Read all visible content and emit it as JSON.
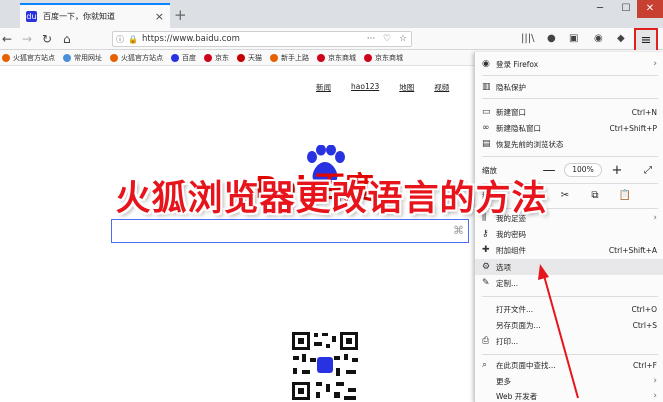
{
  "tab": {
    "title": "百度一下，你就知道",
    "close": "×",
    "favicon": "du"
  },
  "new_tab": "+",
  "window": {
    "minimize": "─",
    "maximize": "☐",
    "close": "✕"
  },
  "nav": {
    "back": "←",
    "forward": "→",
    "reload": "↻",
    "home": "⌂"
  },
  "urlbar": {
    "url": "https://www.baidu.com",
    "info": "ⓘ",
    "lock": "🔒",
    "more": "···",
    "pocket": "♡",
    "star": "☆"
  },
  "toolbar": {
    "library": "|||\\",
    "chat": "●",
    "sidebar": "▣",
    "sync": "◉",
    "extension": "◆",
    "menu": "≡"
  },
  "bookmarks": [
    {
      "label": "火狐官方站点",
      "color": "#e66000"
    },
    {
      "label": "常用网址",
      "color": "#4a90d9"
    },
    {
      "label": "火狐官方站点",
      "color": "#e66000"
    },
    {
      "label": "百度",
      "color": "#2932e1"
    },
    {
      "label": "京东",
      "color": "#d0021b"
    },
    {
      "label": "天猫",
      "color": "#c40000"
    },
    {
      "label": "新手上路",
      "color": "#e66000"
    },
    {
      "label": "京东商城",
      "color": "#d0021b"
    },
    {
      "label": "京东商城",
      "color": "#d0021b"
    }
  ],
  "page": {
    "links": [
      "新闻",
      "hao123",
      "地图",
      "视频"
    ],
    "logo_text": "Bai  百度"
  },
  "menu": {
    "signin": "登录 Firefox",
    "protection": "隐私保护",
    "new_window": "新建窗口",
    "new_window_sc": "Ctrl+N",
    "private_window": "新建隐私窗口",
    "private_window_sc": "Ctrl+Shift+P",
    "restore_session": "恢复先前的浏览状态",
    "zoom_label": "缩放",
    "zoom_minus": "—",
    "zoom_value": "100%",
    "zoom_plus": "+",
    "zoom_full": "⤢",
    "edit_label": "编辑",
    "cut": "✂",
    "copy": "⧉",
    "paste": "📋",
    "library": "我的足迹",
    "passwords": "我的密码",
    "addons": "附加组件",
    "addons_sc": "Ctrl+Shift+A",
    "options": "选项",
    "customize": "定制...",
    "open_file": "打开文件...",
    "open_file_sc": "Ctrl+O",
    "save_page": "另存页面为...",
    "save_page_sc": "Ctrl+S",
    "print": "打印...",
    "find": "在此页面中查找...",
    "find_sc": "Ctrl+F",
    "more": "更多",
    "web_dev": "Web 开发者",
    "arrow_right": "›"
  },
  "caption": "火狐浏览器更改语言的方法",
  "colors": {
    "accent": "#0a84ff",
    "highlight_box": "#e02020",
    "caption": "#e8141c",
    "baidu_red": "#e10601",
    "baidu_blue": "#2932e1"
  }
}
